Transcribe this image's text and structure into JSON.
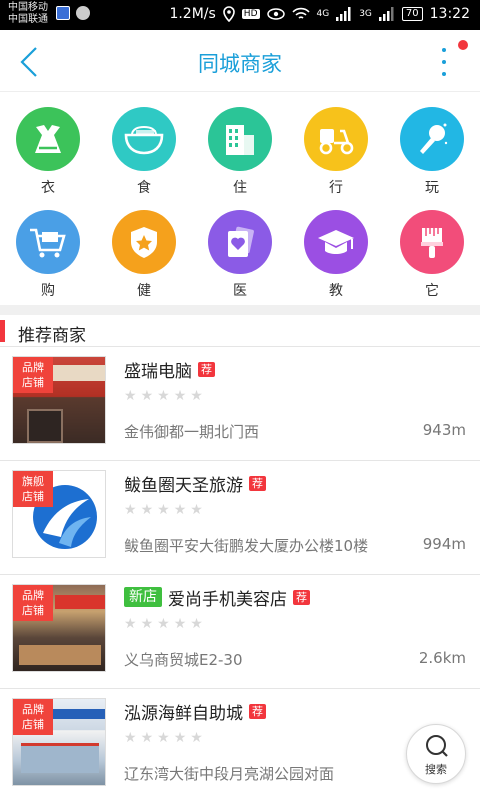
{
  "status_bar": {
    "carrier_1": "中国移动",
    "carrier_2": "中国联通",
    "speed": "1.2M/s",
    "net_4g": "4G",
    "net_3g": "3G",
    "battery": "70",
    "time": "13:22"
  },
  "header": {
    "title": "同城商家",
    "accent_color": "#1a9fd9",
    "notification_dot_color": "#f2363d"
  },
  "categories": [
    {
      "label": "衣",
      "icon": "clothing-icon",
      "color": "#3cc35a"
    },
    {
      "label": "食",
      "icon": "bowl-icon",
      "color": "#2fc9c4"
    },
    {
      "label": "住",
      "icon": "building-icon",
      "color": "#2bc597"
    },
    {
      "label": "行",
      "icon": "scooter-icon",
      "color": "#f7c21b"
    },
    {
      "label": "玩",
      "icon": "microphone-icon",
      "color": "#22b7e4"
    },
    {
      "label": "购",
      "icon": "cart-icon",
      "color": "#4a9fe6"
    },
    {
      "label": "健",
      "icon": "shield-star-icon",
      "color": "#f5a11c"
    },
    {
      "label": "医",
      "icon": "card-heart-icon",
      "color": "#8b5be6"
    },
    {
      "label": "教",
      "icon": "graduation-cap-icon",
      "color": "#9b4fe3"
    },
    {
      "label": "它",
      "icon": "brush-icon",
      "color": "#f24d7a"
    }
  ],
  "section": {
    "title": "推荐商家"
  },
  "merchants": [
    {
      "badge": "品牌\n店铺",
      "name": "盛瑞电脑",
      "rec": "荐",
      "new": "",
      "address": "金伟御都一期北门西",
      "distance": "943m",
      "rating": 0
    },
    {
      "badge": "旗舰\n店铺",
      "name": "鲅鱼圈天圣旅游",
      "rec": "荐",
      "new": "",
      "address": "鲅鱼圈平安大街鹏发大厦办公楼10楼",
      "distance": "994m",
      "rating": 0
    },
    {
      "badge": "品牌\n店铺",
      "name": "爱尚手机美容店",
      "rec": "荐",
      "new": "新店",
      "address": "义乌商贸城E2-30",
      "distance": "2.6km",
      "rating": 0
    },
    {
      "badge": "品牌\n店铺",
      "name": "泓源海鲜自助城",
      "rec": "荐",
      "new": "",
      "address": "辽东湾大街中段月亮湖公园对面",
      "distance": "",
      "rating": 0
    }
  ],
  "fab": {
    "label": "搜索"
  }
}
